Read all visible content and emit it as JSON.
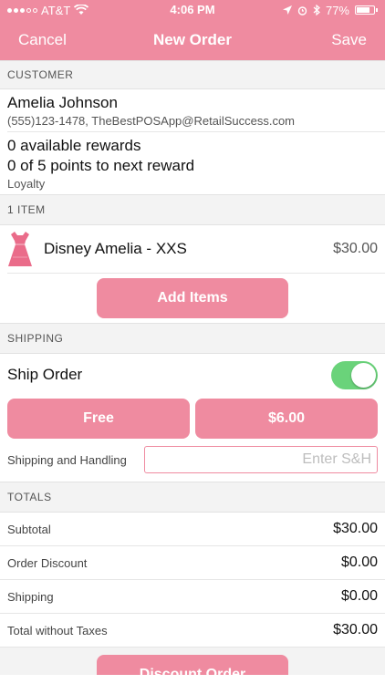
{
  "status_bar": {
    "carrier": "AT&T",
    "time": "4:06 PM",
    "battery": "77%",
    "icons": [
      "signal-icon",
      "wifi-icon",
      "location-icon",
      "alarm-icon",
      "bluetooth-icon",
      "battery-icon"
    ]
  },
  "navbar": {
    "cancel": "Cancel",
    "title": "New Order",
    "save": "Save"
  },
  "customer": {
    "header": "CUSTOMER",
    "name": "Amelia Johnson",
    "contact": "(555)123-1478, TheBestPOSApp@RetailSuccess.com",
    "rewards": "0 available rewards",
    "points": "0 of 5 points to next reward",
    "loyalty": "Loyalty"
  },
  "items": {
    "header": "1 ITEM",
    "list": [
      {
        "name": "Disney Amelia - XXS",
        "price": "$30.00",
        "icon": "dress-icon"
      }
    ],
    "add_button": "Add Items"
  },
  "shipping": {
    "header": "SHIPPING",
    "ship_order_label": "Ship Order",
    "ship_order_on": true,
    "free_button": "Free",
    "rate_button": "$6.00",
    "sh_label": "Shipping and Handling",
    "sh_placeholder": "Enter S&H"
  },
  "totals": {
    "header": "TOTALS",
    "rows": [
      {
        "label": "Subtotal",
        "value": "$30.00"
      },
      {
        "label": "Order Discount",
        "value": "$0.00"
      },
      {
        "label": "Shipping",
        "value": "$0.00"
      },
      {
        "label": "Total without Taxes",
        "value": "$30.00"
      }
    ],
    "discount_button": "Discount Order"
  },
  "colors": {
    "accent": "#ef8ba0",
    "toggle_on": "#6ad37a"
  }
}
